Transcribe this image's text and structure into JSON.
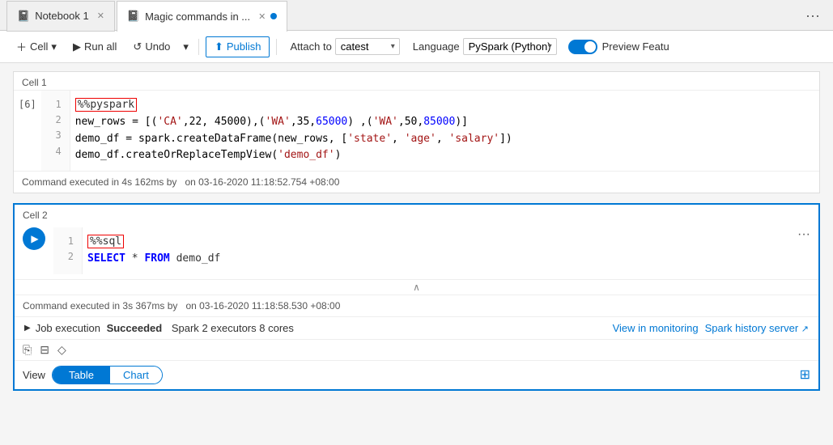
{
  "tabs": [
    {
      "id": "tab1",
      "icon": "notebook-icon",
      "label": "Notebook 1",
      "active": false
    },
    {
      "id": "tab2",
      "icon": "notebook-icon",
      "label": "Magic commands in ...",
      "active": true
    }
  ],
  "toolbar": {
    "cell_label": "Cell",
    "run_all_label": "Run all",
    "undo_label": "Undo",
    "publish_label": "Publish",
    "attach_to_label": "Attach to",
    "attach_value": "catest",
    "language_label": "Language",
    "language_value": "PySpark (Python)",
    "preview_label": "Preview Featu"
  },
  "cell1": {
    "label": "Cell 1",
    "exec_num": "[6]",
    "lines": [
      {
        "num": 1,
        "content": "%%pyspark",
        "type": "magic"
      },
      {
        "num": 2,
        "content": "new_rows = [('CA',22, 45000),('WA',35,65000) ,('WA',50,85000)]",
        "type": "code"
      },
      {
        "num": 3,
        "content": "demo_df = spark.createDataFrame(new_rows, ['state', 'age', 'salary'])",
        "type": "code"
      },
      {
        "num": 4,
        "content": "demo_df.createOrReplaceTempView('demo_df')",
        "type": "code"
      }
    ],
    "status": "Command executed in 4s 162ms by",
    "status_suffix": "on 03-16-2020 11:18:52.754 +08:00"
  },
  "cell2": {
    "label": "Cell 2",
    "lines": [
      {
        "num": 1,
        "content": "%%sql",
        "type": "magic"
      },
      {
        "num": 2,
        "content": "SELECT * FROM demo_df",
        "type": "sql"
      }
    ],
    "status": "Command executed in 3s 367ms by",
    "status_suffix": "on 03-16-2020 11:18:58.530 +08:00",
    "job_status": "Job execution",
    "job_result": "Succeeded",
    "job_spark": "Spark",
    "job_executors": "2 executors 8 cores",
    "view_monitoring_label": "View in monitoring",
    "spark_history_label": "Spark history server",
    "view_label": "View",
    "table_label": "Table",
    "chart_label": "Chart"
  }
}
